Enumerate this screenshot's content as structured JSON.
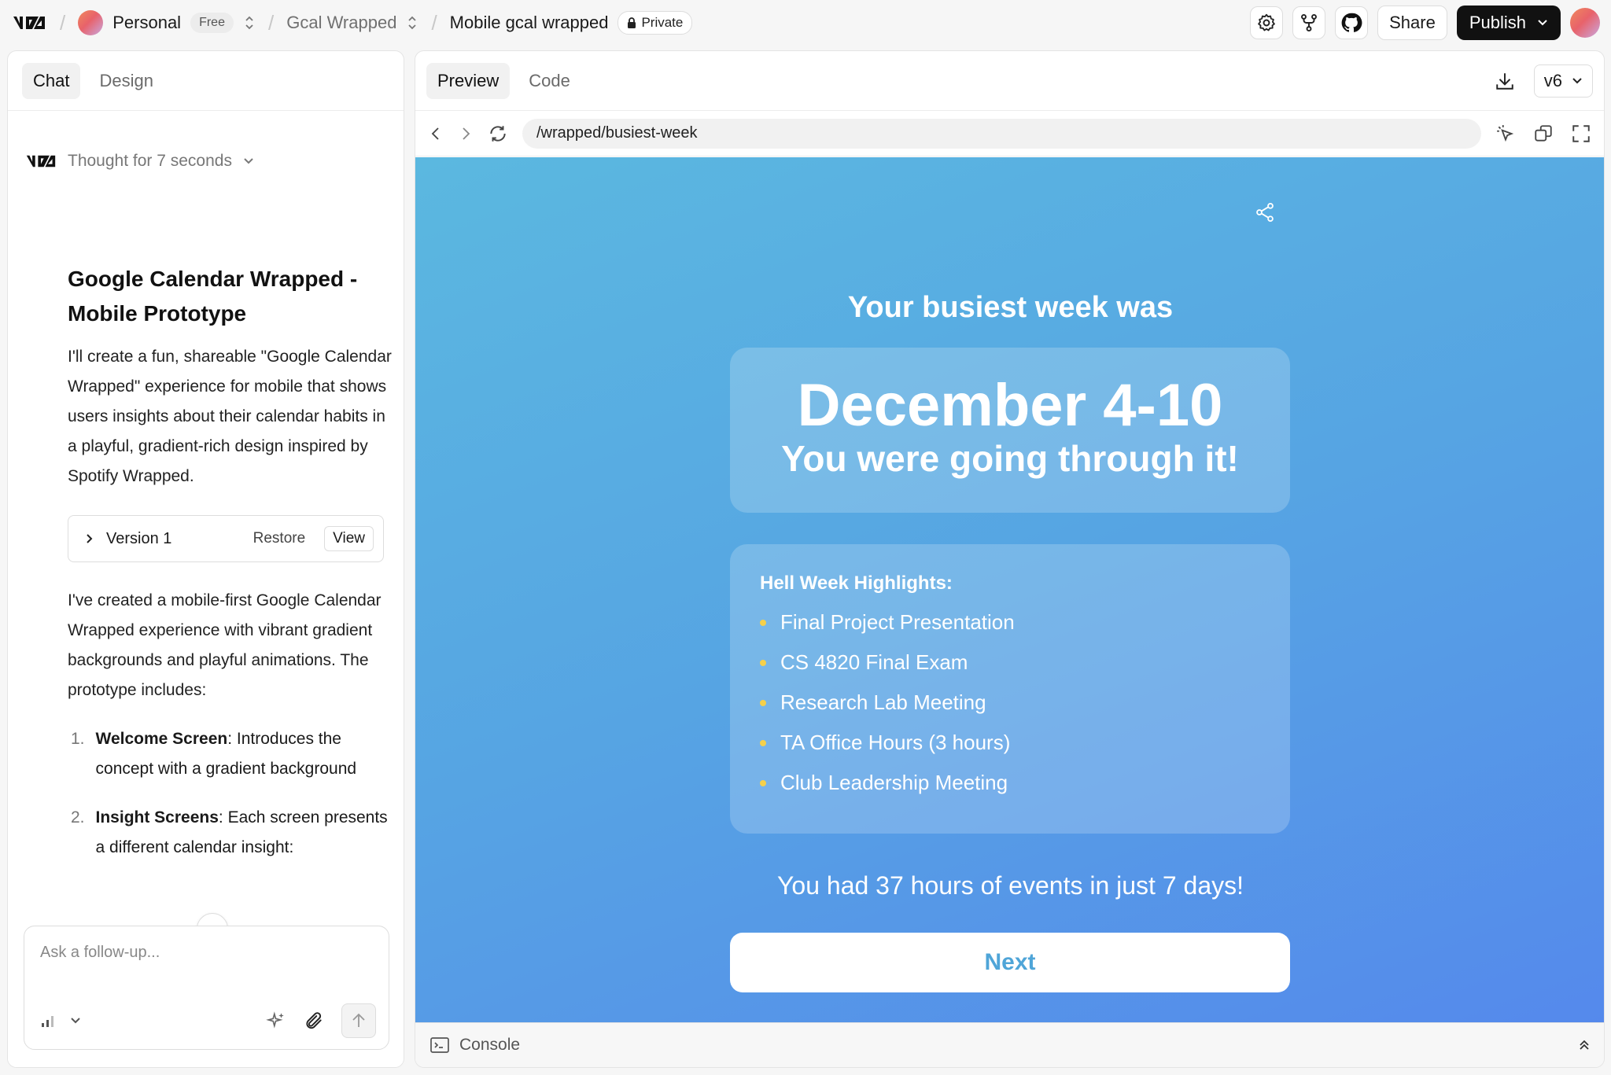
{
  "topbar": {
    "workspace_name": "Personal",
    "workspace_plan": "Free",
    "project_name": "Gcal Wrapped",
    "chat_name": "Mobile gcal wrapped",
    "visibility": "Private",
    "share_label": "Share",
    "publish_label": "Publish",
    "icons": [
      "settings-icon",
      "fork-icon",
      "github-icon"
    ]
  },
  "left_panel": {
    "tabs": [
      {
        "label": "Chat",
        "active": true
      },
      {
        "label": "Design",
        "active": false
      }
    ],
    "thought_label": "Thought for 7 seconds",
    "message": {
      "heading": "Google Calendar Wrapped - Mobile Prototype",
      "intro": "I'll create a fun, shareable \"Google Calendar Wrapped\" experience for mobile that shows users insights about their calendar habits in a playful, gradient-rich design inspired by Spotify Wrapped.",
      "version_label": "Version 1",
      "restore_label": "Restore",
      "view_label": "View",
      "followup": "I've created a mobile-first Google Calendar Wrapped experience with vibrant gradient backgrounds and playful animations. The prototype includes:",
      "list": [
        {
          "num": "1.",
          "bold": "Welcome Screen",
          "text": ": Introduces the concept with a gradient background"
        },
        {
          "num": "2.",
          "bold": "Insight Screens",
          "text": ": Each screen presents a different calendar insight:"
        }
      ]
    },
    "composer_placeholder": "Ask a follow-up..."
  },
  "right_panel": {
    "tabs": [
      {
        "label": "Preview",
        "active": true
      },
      {
        "label": "Code",
        "active": false
      }
    ],
    "version_select": "v6",
    "url": "/wrapped/busiest-week",
    "preview": {
      "headline": "Your busiest week was",
      "date_range": "December 4-10",
      "subtitle": "You were going through it!",
      "highlights_title": "Hell Week Highlights:",
      "highlights": [
        "Final Project Presentation",
        "CS 4820 Final Exam",
        "Research Lab Meeting",
        "TA Office Hours (3 hours)",
        "Club Leadership Meeting"
      ],
      "tagline": "You had 37 hours of events in just 7 days!",
      "next_label": "Next"
    },
    "console_label": "Console"
  },
  "colors": {
    "gradient_start": "#5bb8e0",
    "gradient_end": "#5589ec",
    "bullet": "#f5d04a",
    "next_text": "#4fa5d8",
    "publish_bg": "#111111"
  }
}
